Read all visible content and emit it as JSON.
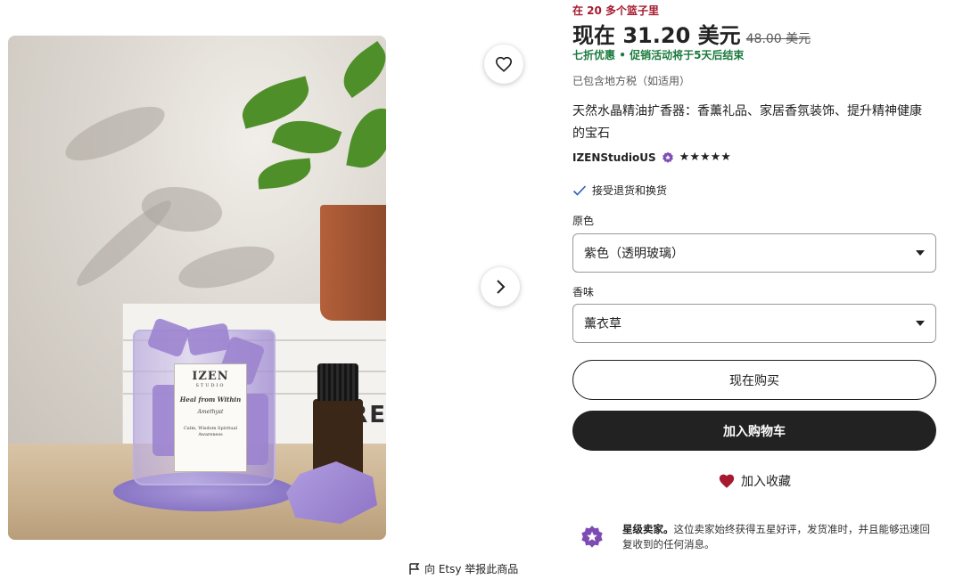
{
  "product": {
    "in_basket_text": "在 20 多个篮子里",
    "price_now": "现在 31.20 美元",
    "price_original": "48.00 美元",
    "discount_text": "七折优惠",
    "sale_separator": "•",
    "sale_ends_text": "促销活动将于5天后结束",
    "tax_note": "已包含地方税（如适用）",
    "title": "天然水晶精油扩香器：香薰礼品、家居香氛装饰、提升精神健康的宝石",
    "shop_name": "IZENStudioUS",
    "rating_stars": 5,
    "star_glyphs": "★★★★★",
    "returns_text": "接受退货和换货"
  },
  "options": {
    "color_label": "原色",
    "color_value": "紫色（透明玻璃）",
    "scent_label": "香味",
    "scent_value": "薰衣草"
  },
  "actions": {
    "buy_now": "现在购买",
    "add_to_cart": "加入购物车",
    "add_to_favorites": "加入收藏"
  },
  "star_seller": {
    "title": "星级卖家。",
    "description": "这位卖家始终获得五星好评，发货准时，并且能够迅速回复收到的任何消息。"
  },
  "image": {
    "brand": "IZEN",
    "brand_sub": "STUDIO",
    "label_heading": "Heal from Within",
    "label_stone": "Amethyst",
    "label_small": "Calm, Wisdom Spiritual Awareness",
    "book_text": "RE"
  },
  "report_link": "向 Etsy 举报此商品",
  "colors": {
    "basket_red": "#a61a2f",
    "sale_green": "#1b7a3e",
    "heart_red": "#a61a2f",
    "star_seller_purple": "#7e4bb5",
    "dark_button": "#222222"
  },
  "icons": [
    "heart-icon",
    "chevron-right-icon",
    "flag-icon",
    "star-seller-badge-icon",
    "checkmark-icon",
    "filled-heart-icon",
    "caret-down-icon"
  ]
}
